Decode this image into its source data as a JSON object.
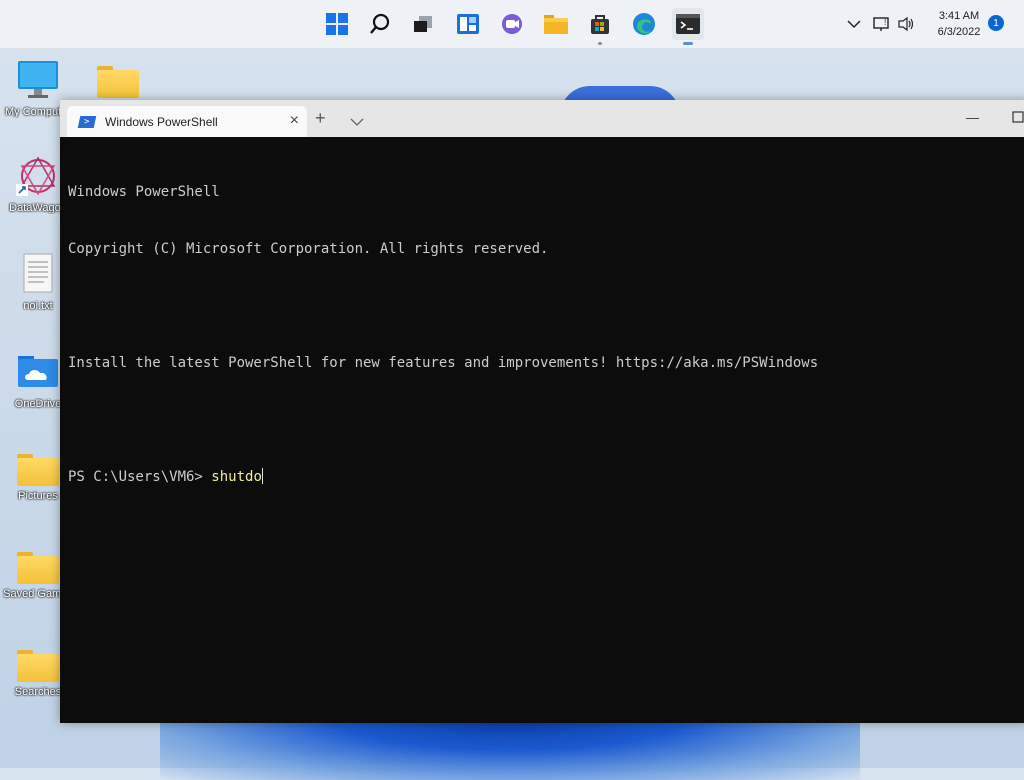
{
  "taskbar": {
    "icons": [
      "windows-start-icon",
      "search-icon",
      "task-view-icon",
      "widgets-icon",
      "chat-icon",
      "file-explorer-icon",
      "store-icon",
      "edge-icon",
      "terminal-icon"
    ],
    "clock_time": "3:41 AM",
    "clock_date": "6/3/2022",
    "notification_count": "1"
  },
  "desktop": {
    "icons": [
      {
        "label": "My Computer"
      },
      {
        "label": "DataWagon"
      },
      {
        "label": "noi.txt"
      },
      {
        "label": "OneDrive"
      },
      {
        "label": "Pictures"
      },
      {
        "label": "Saved Games"
      },
      {
        "label": "Searches"
      }
    ]
  },
  "terminal": {
    "tab_title": "Windows PowerShell",
    "lines": [
      "Windows PowerShell",
      "Copyright (C) Microsoft Corporation. All rights reserved.",
      "",
      "Install the latest PowerShell for new features and improvements! https://aka.ms/PSWindows",
      ""
    ],
    "prompt": "PS C:\\Users\\VM6> ",
    "command": "shutdo"
  },
  "colors": {
    "terminal_bg": "#0c0c0c",
    "terminal_text": "#cccccc",
    "command_text": "#f2ee9a",
    "accent": "#0a66d2"
  }
}
